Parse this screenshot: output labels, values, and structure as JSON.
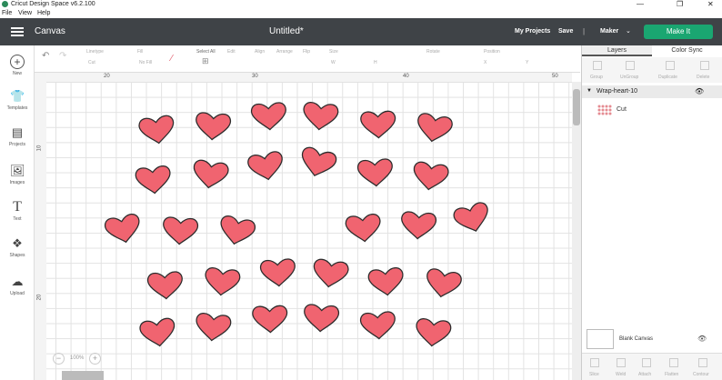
{
  "window": {
    "title": "Cricut Design Space  v6.2.100",
    "controls": [
      "—",
      "❐",
      "✕"
    ]
  },
  "menu": [
    "File",
    "View",
    "Help"
  ],
  "header": {
    "section": "Canvas",
    "doc_title": "Untitled*",
    "my_projects": "My Projects",
    "save": "Save",
    "separator": "|",
    "machine": "Maker",
    "make_it": "Make It"
  },
  "toolbar": {
    "undo_icon": "undo-icon",
    "redo_icon": "redo-icon",
    "linetype_label": "Linetype",
    "linetype_value": "Cut",
    "fill_label": "Fill",
    "fill_value": "No Fill",
    "select_all": "Select All",
    "edit": "Edit",
    "align": "Align",
    "arrange": "Arrange",
    "flip": "Flip",
    "size": "Size",
    "rotate": "Rotate",
    "position": "Position",
    "w_label": "W",
    "h_label": "H",
    "x_label": "X",
    "y_label": "Y"
  },
  "leftnav": [
    {
      "label": "New",
      "icon": "plus-icon"
    },
    {
      "label": "Templates",
      "icon": "shirt-icon"
    },
    {
      "label": "Projects",
      "icon": "projects-icon"
    },
    {
      "label": "Images",
      "icon": "image-icon"
    },
    {
      "label": "Text",
      "icon": "text-icon"
    },
    {
      "label": "Shapes",
      "icon": "shapes-icon"
    },
    {
      "label": "Upload",
      "icon": "upload-icon"
    }
  ],
  "ruler": {
    "top": [
      "20",
      "30",
      "40",
      "50"
    ],
    "left": [
      "10",
      "20"
    ]
  },
  "zoom": {
    "value": "100%",
    "minus": "−",
    "plus": "+"
  },
  "panel": {
    "tabs": [
      "Layers",
      "Color Sync"
    ],
    "tools": [
      "Group",
      "UnGroup",
      "Duplicate",
      "Delete"
    ],
    "layer_name": "Wrap-heart-10",
    "sublayer": "Cut",
    "blank_canvas": "Blank Canvas",
    "bottom_tools": [
      "Slice",
      "Weld",
      "Attach",
      "Flatten",
      "Contour"
    ]
  },
  "colors": {
    "header_bg": "#3f4347",
    "make_it": "#1aa671",
    "heart_fill": "#f06470",
    "heart_stroke": "#2b2b2b"
  },
  "hearts": {
    "count": 30
  }
}
